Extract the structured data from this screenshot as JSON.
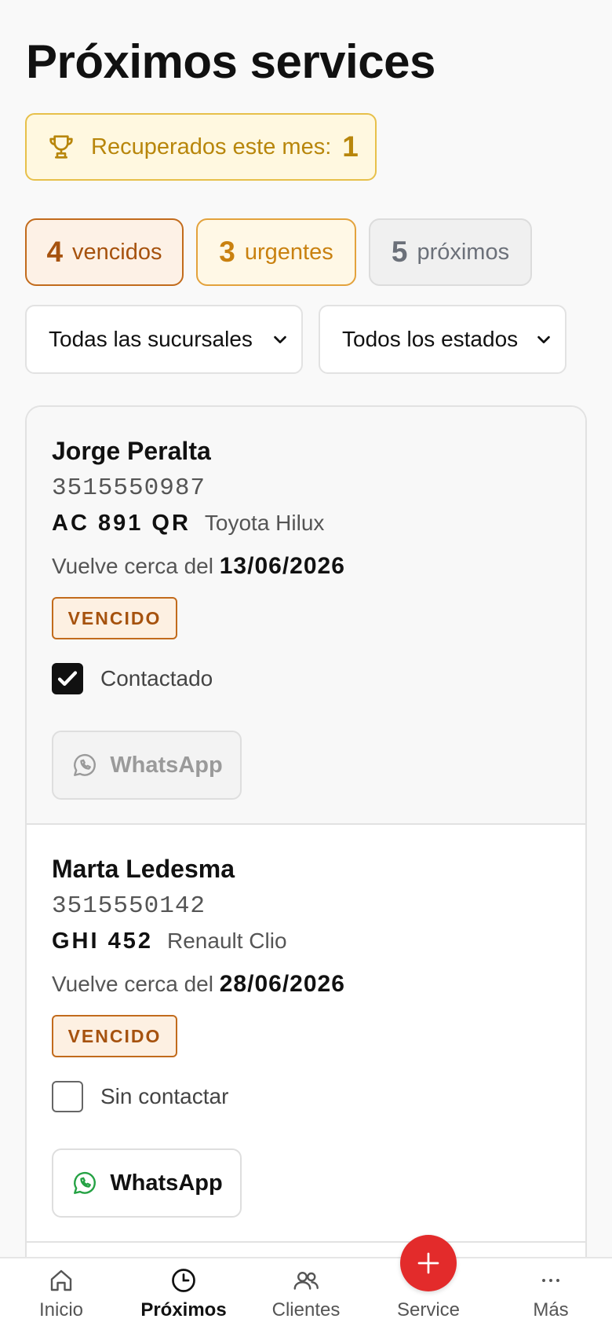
{
  "header": {
    "title": "Próximos services"
  },
  "recovered": {
    "label": "Recuperados este mes:",
    "count": "1"
  },
  "summary": {
    "overdue": {
      "count": "4",
      "label": "vencidos"
    },
    "urgent": {
      "count": "3",
      "label": "urgentes"
    },
    "upcoming": {
      "count": "5",
      "label": "próximos"
    }
  },
  "filters": {
    "branch": {
      "selected": "Todas las sucursales"
    },
    "status": {
      "selected": "Todos los estados"
    }
  },
  "list": {
    "items": [
      {
        "name": "Jorge Peralta",
        "phone": "3515550987",
        "plate": "AC 891 QR",
        "model": "Toyota Hilux",
        "return_prefix": "Vuelve cerca del",
        "return_date": "13/06/2026",
        "status": "VENCIDO",
        "contacted": true,
        "contact_label": "Contactado",
        "action_label": "WhatsApp"
      },
      {
        "name": "Marta Ledesma",
        "phone": "3515550142",
        "plate": "GHI 452",
        "model": "Renault Clio",
        "return_prefix": "Vuelve cerca del",
        "return_date": "28/06/2026",
        "status": "VENCIDO",
        "contacted": false,
        "contact_label": "Sin contactar",
        "action_label": "WhatsApp"
      }
    ]
  },
  "tabbar": {
    "tabs": [
      {
        "label": "Inicio",
        "icon": "home-icon"
      },
      {
        "label": "Próximos",
        "icon": "clock-icon",
        "active": true
      },
      {
        "label": "Clientes",
        "icon": "users-icon"
      },
      {
        "label": "Service",
        "icon": "plus-icon"
      },
      {
        "label": "Más",
        "icon": "more-icon"
      }
    ]
  },
  "colors": {
    "accent_red": "#e32b2b",
    "overdue": "#c26b1c",
    "urgent": "#e3a23c",
    "gold": "#b8860b",
    "whatsapp_green": "#25a244"
  }
}
